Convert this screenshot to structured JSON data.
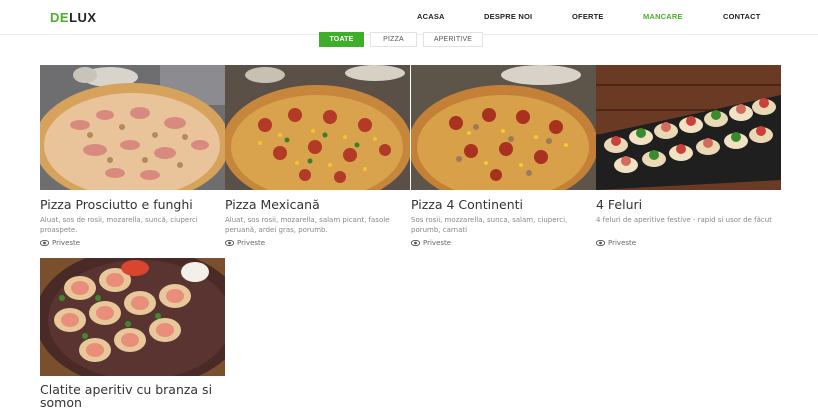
{
  "brand": {
    "accent_part": "DE",
    "rest_part": "LUX",
    "accent_color": "#4caf2a"
  },
  "nav": {
    "items": [
      {
        "label": "ACASA"
      },
      {
        "label": "DESPRE NOI"
      },
      {
        "label": "OFERTE"
      },
      {
        "label": "MANCARE",
        "active": true
      },
      {
        "label": "CONTACT"
      }
    ]
  },
  "filters": [
    {
      "label": "TOATE",
      "active": true
    },
    {
      "label": "PIZZA"
    },
    {
      "label": "APERITIVE"
    }
  ],
  "cards": [
    {
      "title": "Pizza Prosciutto e funghi",
      "description": "Aluat, sos de rosii, mozarella, suncă, ciuperci proaspete.",
      "link_label": "Priveste",
      "image": "pizza-prosciutto-photo"
    },
    {
      "title": "Pizza Mexicană",
      "description": "Aluat, sos rosii, mozarella, salam picant, fasole peruană, ardei gras, porumb.",
      "link_label": "Priveste",
      "image": "pizza-mexicana-photo"
    },
    {
      "title": "Pizza 4 Continenti",
      "description": "Sos rosii, mozzarella, sunca, salam, ciuperci, porumb, carnati",
      "link_label": "Priveste",
      "image": "pizza-4-continenti-photo"
    },
    {
      "title": "4 Feluri",
      "description": "4 feluri de aperitive festive - rapid si usor de făcut",
      "link_label": "Priveste",
      "image": "aperitive-4-feluri-photo"
    },
    {
      "title": "Clatite aperitiv cu branza si somon",
      "image": "clatite-somon-photo"
    }
  ],
  "icons": {
    "eye": "eye-icon"
  }
}
